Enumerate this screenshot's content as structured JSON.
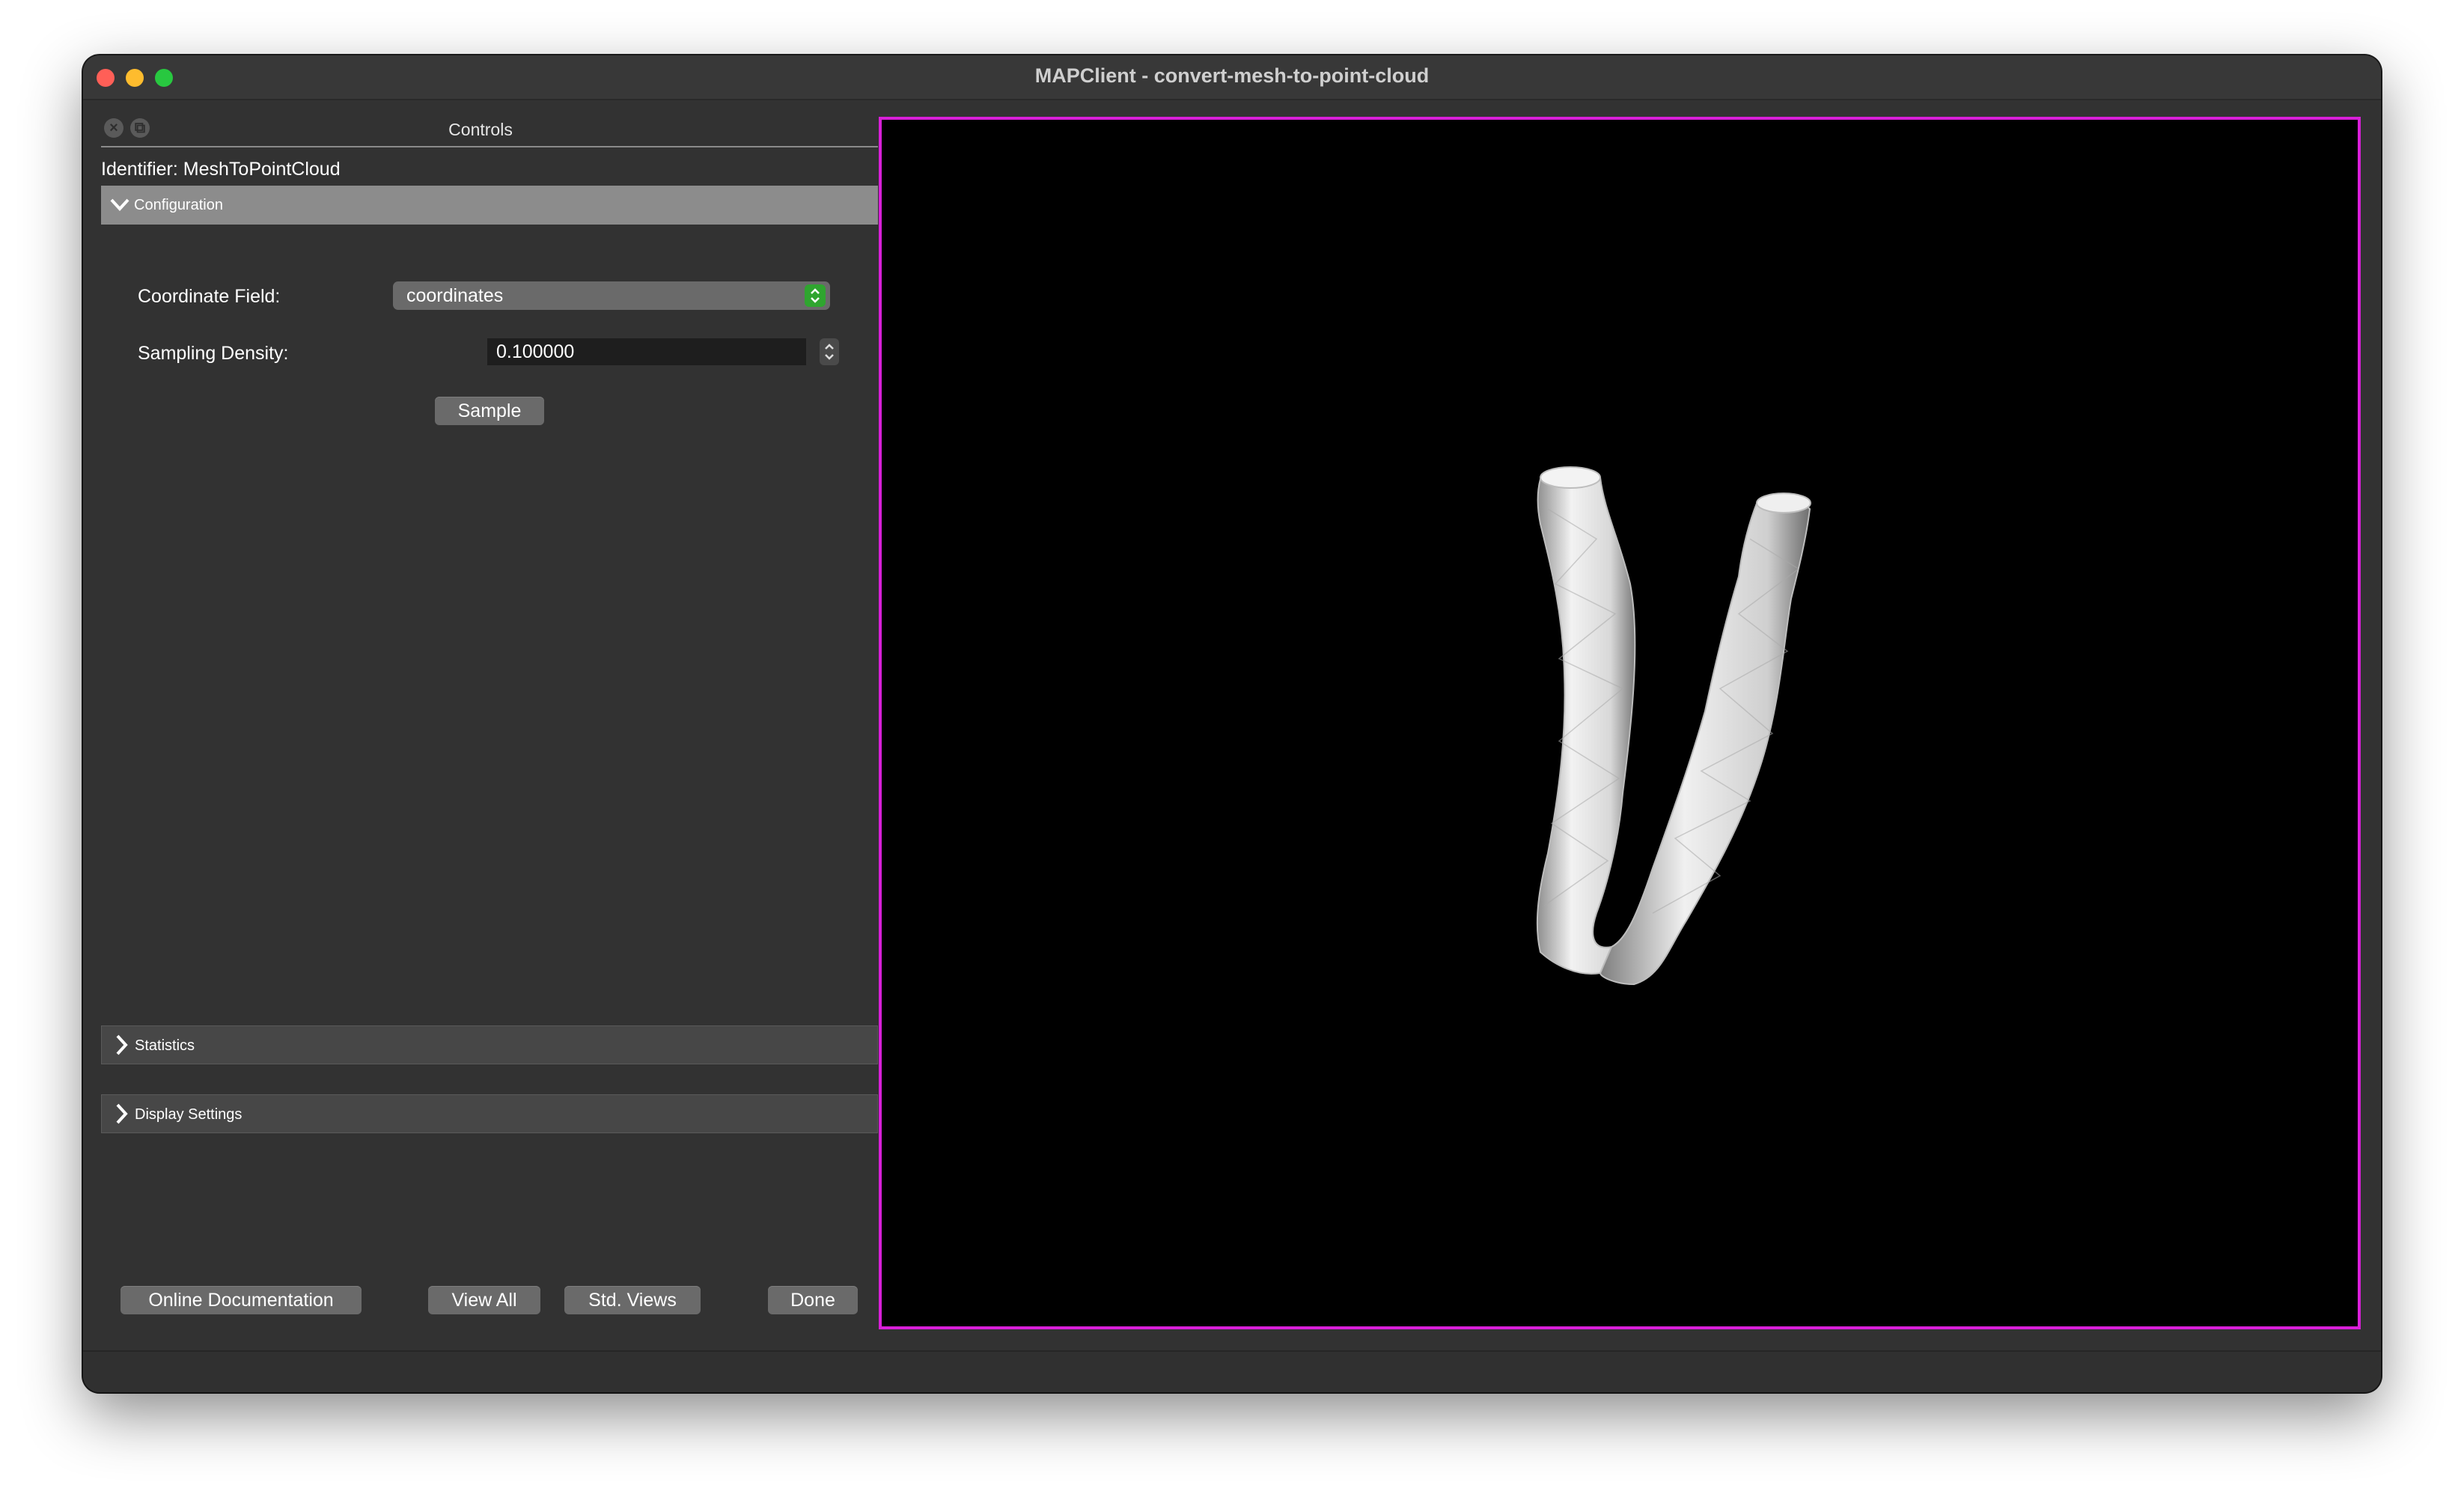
{
  "window": {
    "title": "MAPClient - convert-mesh-to-point-cloud"
  },
  "dock": {
    "title": "Controls",
    "identifier": "Identifier: MeshToPointCloud"
  },
  "configuration": {
    "header": "Configuration",
    "coordinate_field_label": "Coordinate Field:",
    "coordinate_field_value": "coordinates",
    "sampling_density_label": "Sampling Density:",
    "sampling_density_value": "0.100000",
    "sample_button": "Sample"
  },
  "sections": {
    "statistics": "Statistics",
    "display_settings": "Display Settings"
  },
  "footer": {
    "online_documentation": "Online Documentation",
    "view_all": "View All",
    "std_views": "Std. Views",
    "done": "Done"
  },
  "icons": {
    "dock_close": "close-icon",
    "dock_float": "float-icon",
    "expanded": "chevron-down-icon",
    "collapsed": "chevron-right-icon",
    "combo": "updown-icon"
  },
  "colors": {
    "viewer_border": "#d81fd8",
    "viewer_background": "#000000",
    "combo_accent": "#2fa52f",
    "mesh": "#e8e8e8"
  }
}
